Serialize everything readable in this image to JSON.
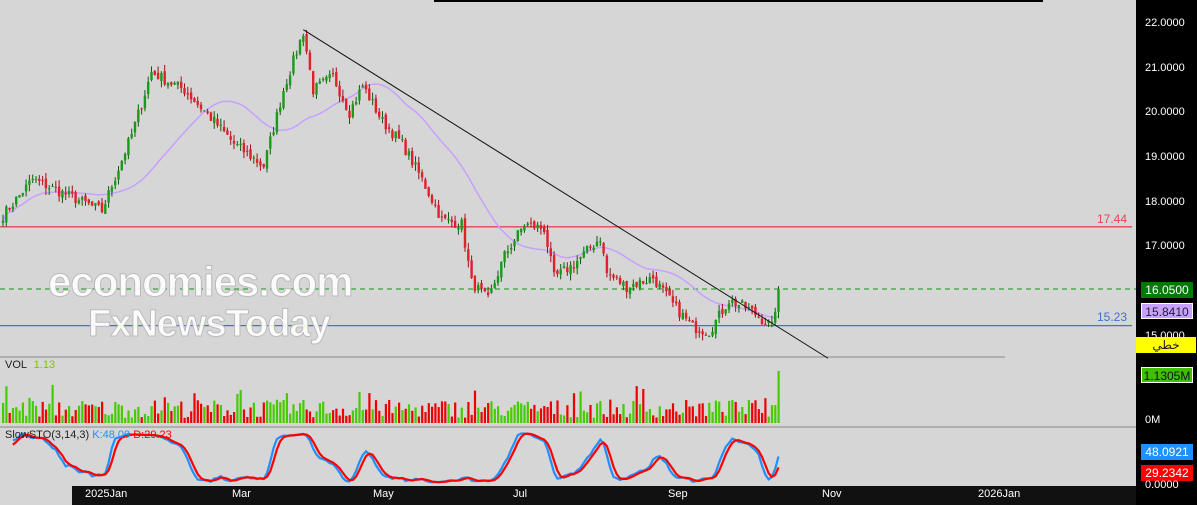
{
  "chart_data": {
    "type": "candlestick",
    "title": "",
    "price_axis": {
      "ticks": [
        "22.0000",
        "21.0000",
        "20.0000",
        "19.0000",
        "18.0000",
        "17.0000",
        "15.0000"
      ],
      "ylim": [
        14.5,
        22.3
      ]
    },
    "date_axis": {
      "ticks": [
        "2025Jan",
        "Mar",
        "May",
        "Jul",
        "Sep",
        "Nov",
        "2026Jan"
      ]
    },
    "close_anchors": [
      [
        0,
        17.7
      ],
      [
        9,
        18.5
      ],
      [
        24,
        18.0
      ],
      [
        30,
        17.8
      ],
      [
        39,
        19.5
      ],
      [
        45,
        20.9
      ],
      [
        55,
        20.5
      ],
      [
        64,
        19.8
      ],
      [
        70,
        19.3
      ],
      [
        79,
        18.8
      ],
      [
        85,
        20.5
      ],
      [
        91,
        21.8
      ],
      [
        94,
        20.5
      ],
      [
        100,
        20.8
      ],
      [
        105,
        20.0
      ],
      [
        109,
        20.6
      ],
      [
        115,
        19.8
      ],
      [
        121,
        19.3
      ],
      [
        127,
        18.5
      ],
      [
        133,
        17.6
      ],
      [
        139,
        17.5
      ],
      [
        142,
        16.2
      ],
      [
        147,
        15.8
      ],
      [
        152,
        16.8
      ],
      [
        158,
        17.5
      ],
      [
        164,
        17.4
      ],
      [
        167,
        16.3
      ],
      [
        173,
        16.6
      ],
      [
        181,
        17.2
      ],
      [
        183,
        16.4
      ],
      [
        189,
        16.1
      ],
      [
        197,
        16.3
      ],
      [
        203,
        15.7
      ],
      [
        209,
        15.2
      ],
      [
        214,
        15.1
      ],
      [
        220,
        15.8
      ],
      [
        226,
        15.6
      ],
      [
        233,
        15.2
      ],
      [
        235,
        16.05
      ]
    ],
    "levels": [
      {
        "label": "17.44",
        "value": 17.44,
        "color": "#e8454f"
      },
      {
        "label": "15.23",
        "value": 15.23,
        "color": "#4a6bd8"
      }
    ],
    "last_price": {
      "label": "16.0500",
      "value": 16.05,
      "color": "#007a00"
    },
    "ma": {
      "label": "15.8410",
      "value": 15.841,
      "color": "#c8a0ff"
    },
    "trendline": {
      "from": [
        91,
        21.85
      ],
      "to": [
        250,
        14.5
      ]
    },
    "line_type_label": "خطي",
    "volume": {
      "title": "VOL",
      "value": "1.13",
      "last_label": "1.1305M",
      "zero_label": "0M"
    },
    "stoch": {
      "title": "SlowSTO(3,14,3)",
      "k_label": "K:48.09",
      "d_label": "D:29.23",
      "k_value": "48.0921",
      "d_value": "29.2342",
      "zero_label": "0.0000",
      "k_color": "#1e90ff",
      "d_color": "#ff0000"
    }
  },
  "watermark": {
    "line1": "economies.com",
    "line2": "FxNewsToday"
  }
}
